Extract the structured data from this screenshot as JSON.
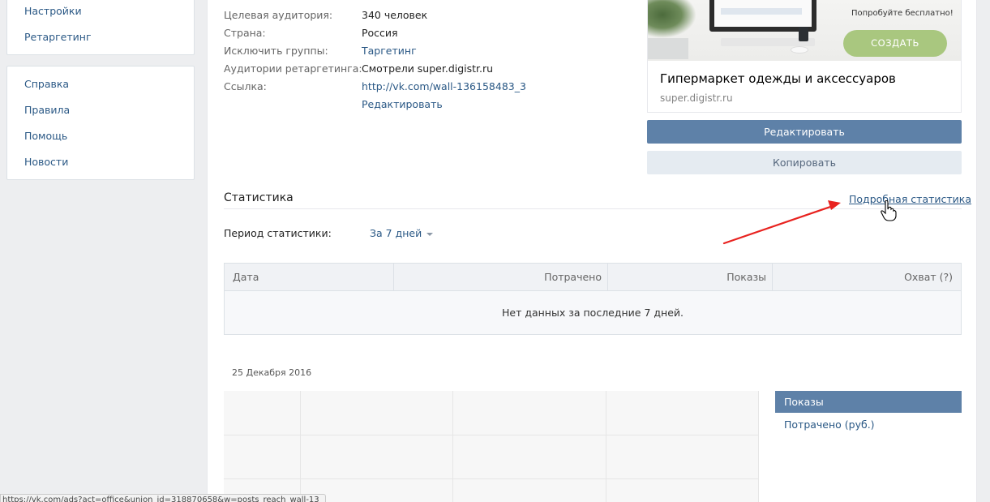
{
  "sidebar": {
    "top_items": [
      {
        "label": "Настройки"
      },
      {
        "label": "Ретаргетинг"
      }
    ],
    "bottom_items": [
      {
        "label": "Справка"
      },
      {
        "label": "Правила"
      },
      {
        "label": "Помощь"
      },
      {
        "label": "Новости"
      }
    ]
  },
  "params": [
    {
      "label": "Целевая аудитория:",
      "value": "340 человек"
    },
    {
      "label": "Страна:",
      "value": "Россия"
    },
    {
      "label": "Исключить группы:",
      "value": "Таргетинг"
    },
    {
      "label": "Аудитории ретаргетинга:",
      "value": "Смотрели super.digistr.ru"
    },
    {
      "label": "Ссылка:",
      "value": "http://vk.com/wall-136158483_3"
    }
  ],
  "edit_link": "Редактировать",
  "ad": {
    "tagline": "Попробуйте бесплатно!",
    "cta": "СОЗДАТЬ",
    "title": "Гипермаркет одежды и аксессуаров",
    "domain": "super.digistr.ru"
  },
  "buttons": {
    "edit": "Редактировать",
    "copy": "Копировать"
  },
  "stats": {
    "title": "Статистика",
    "detail_link": "Подробная статистика",
    "period_label": "Период статистики:",
    "period_value": "За 7 дней",
    "columns": [
      "Дата",
      "Потрачено",
      "Показы",
      "Охват (?)"
    ],
    "empty_text": "Нет данных за последние 7 дней."
  },
  "graph": {
    "date_label": "25 Декабря 2016",
    "legend": [
      "Показы",
      "Потрачено (руб.)"
    ]
  },
  "statusbar": {
    "url": "https://vk.com/ads?act=office&union_id=318870658&w=posts_reach_wall-13"
  },
  "colors": {
    "accent": "#5e81a8",
    "link": "#2a5885",
    "arrow": "#e8221f",
    "cta": "#a9c77f"
  }
}
